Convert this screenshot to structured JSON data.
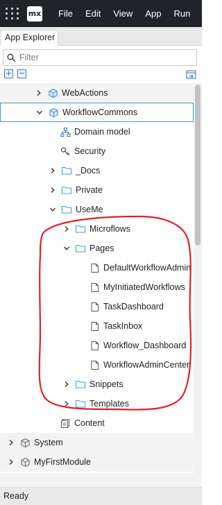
{
  "menubar": {
    "logo_text": "mx",
    "items": [
      "File",
      "Edit",
      "View",
      "App",
      "Run"
    ]
  },
  "tab": {
    "label": "App Explorer"
  },
  "filter": {
    "placeholder": "Filter"
  },
  "tree": [
    {
      "label": "WebActions",
      "icon": "module-icon",
      "chevron": "right"
    },
    {
      "label": "WorkflowCommons",
      "icon": "module-icon",
      "chevron": "down",
      "selected": true
    },
    {
      "label": "Domain model",
      "icon": "domain-model-icon",
      "chevron": ""
    },
    {
      "label": "Security",
      "icon": "security-key-icon",
      "chevron": ""
    },
    {
      "label": "_Docs",
      "icon": "folder-icon",
      "chevron": "right"
    },
    {
      "label": "Private",
      "icon": "folder-icon",
      "chevron": "right"
    },
    {
      "label": "UseMe",
      "icon": "folder-icon",
      "chevron": "down"
    },
    {
      "label": "Microflows",
      "icon": "folder-icon",
      "chevron": "right"
    },
    {
      "label": "Pages",
      "icon": "folder-icon",
      "chevron": "down"
    },
    {
      "label": "DefaultWorkflowAdmin",
      "icon": "page-icon",
      "chevron": ""
    },
    {
      "label": "MyInitiatedWorkflows",
      "icon": "page-icon",
      "chevron": ""
    },
    {
      "label": "TaskDashboard",
      "icon": "page-icon",
      "chevron": ""
    },
    {
      "label": "TaskInbox",
      "icon": "page-icon",
      "chevron": ""
    },
    {
      "label": "Workflow_Dashboard",
      "icon": "page-icon",
      "chevron": ""
    },
    {
      "label": "WorkflowAdminCenter",
      "icon": "page-icon",
      "chevron": ""
    },
    {
      "label": "Snippets",
      "icon": "folder-icon",
      "chevron": "right"
    },
    {
      "label": "Templates",
      "icon": "folder-icon",
      "chevron": "right"
    },
    {
      "label": "Content",
      "icon": "content-icon",
      "chevron": ""
    },
    {
      "label": "System",
      "icon": "module-gray-icon",
      "chevron": "right"
    },
    {
      "label": "MyFirstModule",
      "icon": "module-gray-icon",
      "chevron": "right"
    }
  ],
  "status": {
    "text": "Ready"
  },
  "colors": {
    "menubar_bg": "#202327",
    "selection_border": "#3a97dd",
    "module_icon": "#3b8fd9",
    "folder_icon": "#4a9be0",
    "annotation": "#e0202a"
  }
}
